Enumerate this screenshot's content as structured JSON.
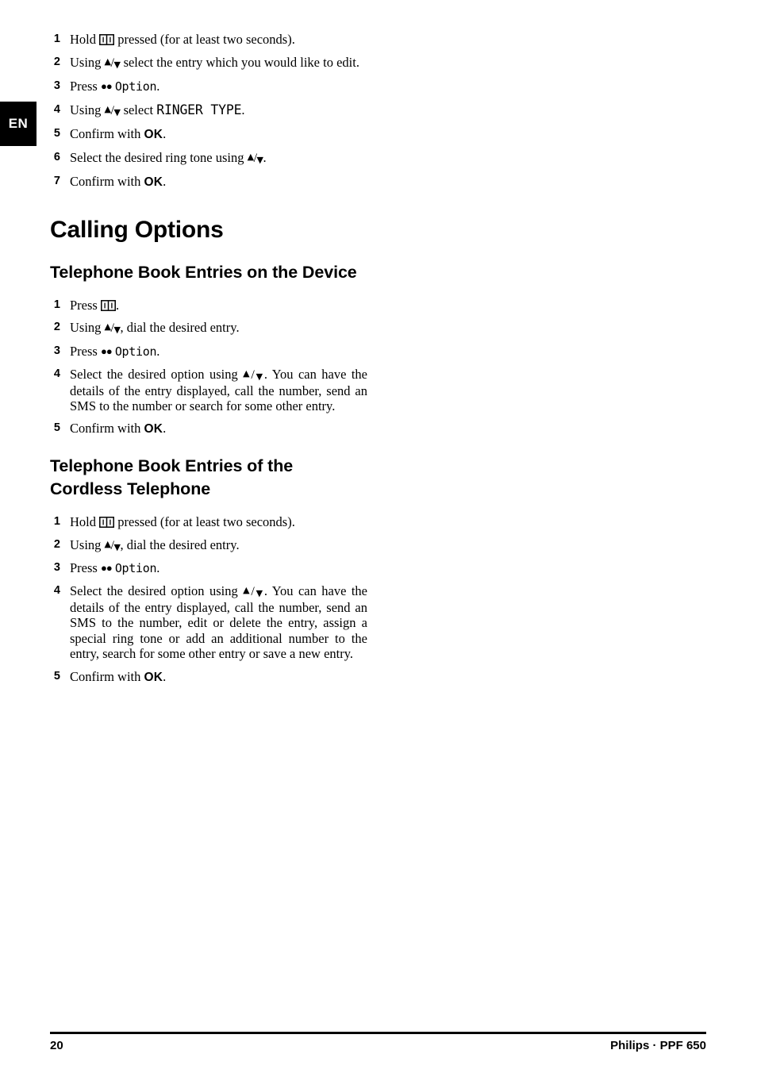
{
  "language_tab": {
    "label": "EN"
  },
  "top_steps": [
    {
      "num": "1",
      "parts": [
        {
          "t": "text",
          "v": "Hold "
        },
        {
          "t": "book"
        },
        {
          "t": "text",
          "v": " pressed (for at least two seconds)."
        }
      ]
    },
    {
      "num": "2",
      "parts": [
        {
          "t": "text",
          "v": "Using "
        },
        {
          "t": "arrows"
        },
        {
          "t": "text",
          "v": " select the entry which you would like to edit."
        }
      ]
    },
    {
      "num": "3",
      "parts": [
        {
          "t": "text",
          "v": "Press "
        },
        {
          "t": "dots",
          "v": "●●"
        },
        {
          "t": "text",
          "v": " "
        },
        {
          "t": "lcd",
          "v": "Option"
        },
        {
          "t": "text",
          "v": "."
        }
      ]
    },
    {
      "num": "4",
      "parts": [
        {
          "t": "text",
          "v": "Using "
        },
        {
          "t": "arrows"
        },
        {
          "t": "text",
          "v": " select "
        },
        {
          "t": "lcdcaps",
          "v": "RINGER TYPE"
        },
        {
          "t": "text",
          "v": "."
        }
      ]
    },
    {
      "num": "5",
      "parts": [
        {
          "t": "text",
          "v": "Confirm with "
        },
        {
          "t": "bold",
          "v": "OK"
        },
        {
          "t": "text",
          "v": "."
        }
      ]
    },
    {
      "num": "6",
      "parts": [
        {
          "t": "text",
          "v": "Select the desired ring tone using "
        },
        {
          "t": "arrows"
        },
        {
          "t": "text",
          "v": "."
        }
      ]
    },
    {
      "num": "7",
      "parts": [
        {
          "t": "text",
          "v": "Confirm with "
        },
        {
          "t": "bold",
          "v": "OK"
        },
        {
          "t": "text",
          "v": "."
        }
      ]
    }
  ],
  "chapter": {
    "title": "Calling Options"
  },
  "sections": [
    {
      "heading": "Telephone Book Entries on the Device",
      "steps": [
        {
          "num": "1",
          "parts": [
            {
              "t": "text",
              "v": "Press "
            },
            {
              "t": "book"
            },
            {
              "t": "text",
              "v": "."
            }
          ]
        },
        {
          "num": "2",
          "parts": [
            {
              "t": "text",
              "v": "Using "
            },
            {
              "t": "arrows"
            },
            {
              "t": "text",
              "v": ", dial the desired entry."
            }
          ]
        },
        {
          "num": "3",
          "parts": [
            {
              "t": "text",
              "v": "Press "
            },
            {
              "t": "dots",
              "v": "●●"
            },
            {
              "t": "text",
              "v": " "
            },
            {
              "t": "lcd",
              "v": "Option"
            },
            {
              "t": "text",
              "v": "."
            }
          ]
        },
        {
          "num": "4",
          "parts": [
            {
              "t": "text",
              "v": "Select the desired option using "
            },
            {
              "t": "arrows"
            },
            {
              "t": "text",
              "v": ". You can have the details of the entry displayed, call the number, send an SMS to the number or search for some other entry."
            }
          ]
        },
        {
          "num": "5",
          "parts": [
            {
              "t": "text",
              "v": "Confirm with "
            },
            {
              "t": "bold",
              "v": "OK"
            },
            {
              "t": "text",
              "v": "."
            }
          ]
        }
      ]
    },
    {
      "heading": "Telephone Book Entries of the Cordless Telephone",
      "steps": [
        {
          "num": "1",
          "parts": [
            {
              "t": "text",
              "v": "Hold "
            },
            {
              "t": "book"
            },
            {
              "t": "text",
              "v": " pressed (for at least two seconds)."
            }
          ]
        },
        {
          "num": "2",
          "parts": [
            {
              "t": "text",
              "v": "Using "
            },
            {
              "t": "arrows"
            },
            {
              "t": "text",
              "v": ", dial the desired entry."
            }
          ]
        },
        {
          "num": "3",
          "parts": [
            {
              "t": "text",
              "v": "Press "
            },
            {
              "t": "dots",
              "v": "●●"
            },
            {
              "t": "text",
              "v": " "
            },
            {
              "t": "lcd",
              "v": "Option"
            },
            {
              "t": "text",
              "v": "."
            }
          ]
        },
        {
          "num": "4",
          "parts": [
            {
              "t": "text",
              "v": "Select the desired option using "
            },
            {
              "t": "arrows"
            },
            {
              "t": "text",
              "v": ". You can have the details of the entry displayed, call the number, send an SMS to the number, edit or delete the entry, assign a special ring tone or add an additional number to the entry, search for some other entry or save a new entry."
            }
          ]
        },
        {
          "num": "5",
          "parts": [
            {
              "t": "text",
              "v": "Confirm with "
            },
            {
              "t": "bold",
              "v": "OK"
            },
            {
              "t": "text",
              "v": "."
            }
          ]
        }
      ]
    }
  ],
  "footer": {
    "page_number": "20",
    "brand": "Philips · PPF 650"
  }
}
